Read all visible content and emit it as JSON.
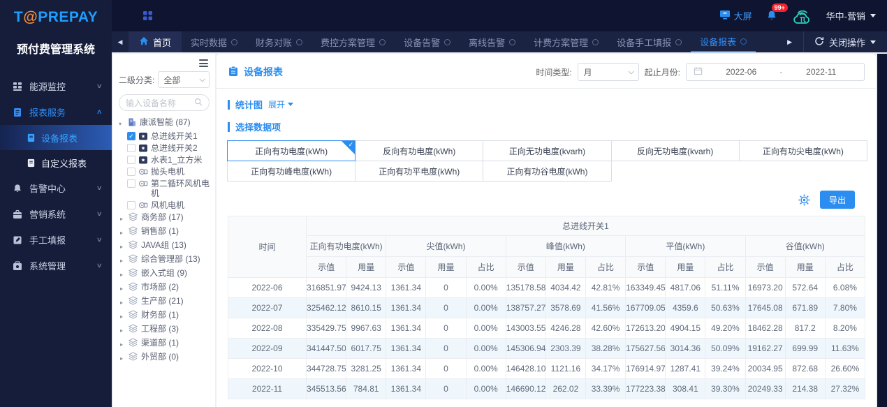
{
  "brand": {
    "logo_prefix": "T",
    "logo_at": "@",
    "logo_suffix": "PREPAY",
    "subtitle": "预付费管理系统"
  },
  "topbar": {
    "big_screen": "大屏",
    "notification_count": "99+",
    "user": "华中-营销"
  },
  "tabbar": {
    "back_home": "首页",
    "tabs": [
      {
        "label": "实时数据"
      },
      {
        "label": "财务对账"
      },
      {
        "label": "费控方案管理"
      },
      {
        "label": "设备告警"
      },
      {
        "label": "离线告警"
      },
      {
        "label": "计费方案管理"
      },
      {
        "label": "设备手工填报"
      },
      {
        "label": "设备报表",
        "active": true
      }
    ],
    "close_action": "关闭操作"
  },
  "sidebar": {
    "menu": [
      {
        "label": "能源监控",
        "icon": "energy-monitor-icon",
        "state": "collapsed"
      },
      {
        "label": "报表服务",
        "icon": "report-service-icon",
        "state": "expanded",
        "active": true,
        "children": [
          {
            "label": "设备报表",
            "active": true
          },
          {
            "label": "自定义报表",
            "active": false
          }
        ]
      },
      {
        "label": "告警中心",
        "icon": "alarm-center-icon",
        "state": "collapsed"
      },
      {
        "label": "营销系统",
        "icon": "marketing-icon",
        "state": "collapsed"
      },
      {
        "label": "手工填报",
        "icon": "manual-entry-icon",
        "state": "collapsed"
      },
      {
        "label": "系统管理",
        "icon": "system-manage-icon",
        "state": "collapsed"
      }
    ]
  },
  "tree": {
    "category_label": "二级分类:",
    "category_value": "全部",
    "search_placeholder": "输入设备名称",
    "root_label": "康派智能 (87)",
    "devices": [
      {
        "label": "总进线开关1",
        "icon": "meter-icon",
        "checked": true
      },
      {
        "label": "总进线开关2",
        "icon": "meter-icon",
        "checked": false
      },
      {
        "label": "水表1_立方米",
        "icon": "meter-icon",
        "checked": false
      },
      {
        "label": "抛头电机",
        "icon": "motor-icon",
        "checked": false
      },
      {
        "label": "第二循环风机电机",
        "icon": "motor-icon",
        "checked": false
      },
      {
        "label": "风机电机",
        "icon": "motor-icon",
        "checked": false
      }
    ],
    "departments": [
      {
        "label": "商务部 (17)"
      },
      {
        "label": "销售部 (1)"
      },
      {
        "label": "JAVA组 (13)"
      },
      {
        "label": "综合管理部 (13)"
      },
      {
        "label": "嵌入式组 (9)"
      },
      {
        "label": "市场部 (2)"
      },
      {
        "label": "生产部 (21)"
      },
      {
        "label": "财务部 (1)"
      },
      {
        "label": "工程部 (3)"
      },
      {
        "label": "渠道部 (1)"
      },
      {
        "label": "外贸部 (0)"
      }
    ]
  },
  "page": {
    "title": "设备报表",
    "time_type_label": "时间类型:",
    "time_type_value": "月",
    "range_label": "起止月份:",
    "range_start": "2022-06",
    "range_separator": "-",
    "range_end": "2022-11",
    "chart_section_title": "统计图",
    "chart_toggle": "展开",
    "select_section_title": "选择数据项",
    "data_items": [
      {
        "label": "正向有功电度(kWh)",
        "selected": true
      },
      {
        "label": "反向有功电度(kWh)",
        "selected": false
      },
      {
        "label": "正向无功电度(kvarh)",
        "selected": false
      },
      {
        "label": "反向无功电度(kvarh)",
        "selected": false
      },
      {
        "label": "正向有功尖电度(kWh)",
        "selected": false
      },
      {
        "label": "正向有功峰电度(kWh)",
        "selected": false
      },
      {
        "label": "正向有功平电度(kWh)",
        "selected": false
      },
      {
        "label": "正向有功谷电度(kWh)",
        "selected": false
      }
    ],
    "export_label": "导出",
    "table": {
      "time_col": "时间",
      "device_col": "总进线开关1",
      "groups": [
        {
          "label": "正向有功电度(kWh)",
          "sub": [
            "示值",
            "用量"
          ]
        },
        {
          "label": "尖值(kWh)",
          "sub": [
            "示值",
            "用量",
            "占比"
          ]
        },
        {
          "label": "峰值(kWh)",
          "sub": [
            "示值",
            "用量",
            "占比"
          ]
        },
        {
          "label": "平值(kWh)",
          "sub": [
            "示值",
            "用量",
            "占比"
          ]
        },
        {
          "label": "谷值(kWh)",
          "sub": [
            "示值",
            "用量",
            "占比"
          ]
        }
      ],
      "rows": [
        [
          "2022-06",
          "316851.97",
          "9424.13",
          "1361.34",
          "0",
          "0.00%",
          "135178.58",
          "4034.42",
          "42.81%",
          "163349.45",
          "4817.06",
          "51.11%",
          "16973.20",
          "572.64",
          "6.08%"
        ],
        [
          "2022-07",
          "325462.12",
          "8610.15",
          "1361.34",
          "0",
          "0.00%",
          "138757.27",
          "3578.69",
          "41.56%",
          "167709.05",
          "4359.6",
          "50.63%",
          "17645.08",
          "671.89",
          "7.80%"
        ],
        [
          "2022-08",
          "335429.75",
          "9967.63",
          "1361.34",
          "0",
          "0.00%",
          "143003.55",
          "4246.28",
          "42.60%",
          "172613.20",
          "4904.15",
          "49.20%",
          "18462.28",
          "817.2",
          "8.20%"
        ],
        [
          "2022-09",
          "341447.50",
          "6017.75",
          "1361.34",
          "0",
          "0.00%",
          "145306.94",
          "2303.39",
          "38.28%",
          "175627.56",
          "3014.36",
          "50.09%",
          "19162.27",
          "699.99",
          "11.63%"
        ],
        [
          "2022-10",
          "344728.75",
          "3281.25",
          "1361.34",
          "0",
          "0.00%",
          "146428.10",
          "1121.16",
          "34.17%",
          "176914.97",
          "1287.41",
          "39.24%",
          "20034.95",
          "872.68",
          "26.60%"
        ],
        [
          "2022-11",
          "345513.56",
          "784.81",
          "1361.34",
          "0",
          "0.00%",
          "146690.12",
          "262.02",
          "33.39%",
          "177223.38",
          "308.41",
          "39.30%",
          "20249.33",
          "214.38",
          "27.32%"
        ]
      ]
    }
  },
  "colors": {
    "accent": "#2b8df0",
    "logo_blue": "#1e9fff",
    "logo_orange": "#ef8b3c",
    "badge_red": "#f5222d",
    "cloud_teal": "#2fd3bd",
    "sidebar_bg": "#151d3b",
    "topbar_bg": "#0f1530",
    "tabbar_bg": "#1a2342",
    "row_alt_bg": "#f0f7fc"
  }
}
